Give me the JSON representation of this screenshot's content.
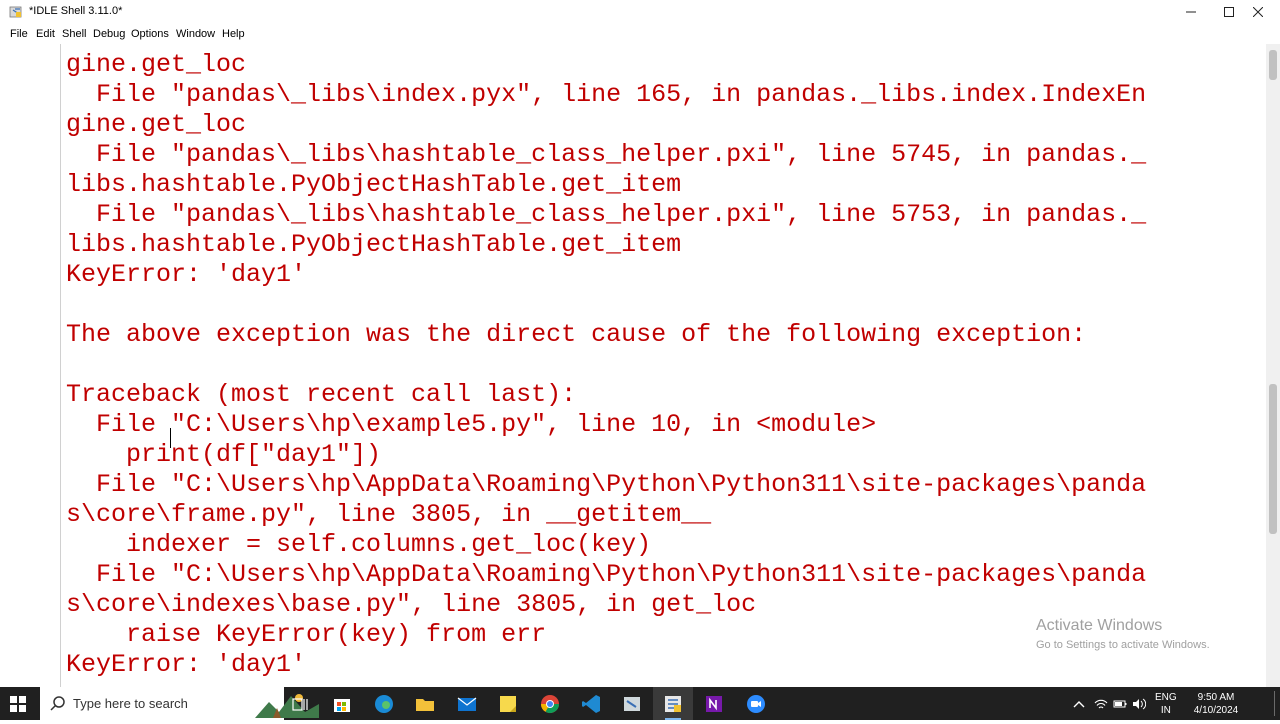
{
  "window": {
    "title": "*IDLE Shell 3.11.0*",
    "controls": {
      "minimize": "—",
      "maximize": "☐",
      "close": "✕"
    }
  },
  "menu": {
    "file": "File",
    "edit": "Edit",
    "shell": "Shell",
    "debug": "Debug",
    "options": "Options",
    "window": "Window",
    "help": "Help"
  },
  "shell": {
    "lines": [
      "gine.get_loc",
      "  File \"pandas\\_libs\\index.pyx\", line 165, in pandas._libs.index.IndexEn",
      "gine.get_loc",
      "  File \"pandas\\_libs\\hashtable_class_helper.pxi\", line 5745, in pandas._",
      "libs.hashtable.PyObjectHashTable.get_item",
      "  File \"pandas\\_libs\\hashtable_class_helper.pxi\", line 5753, in pandas._",
      "libs.hashtable.PyObjectHashTable.get_item",
      "KeyError: 'day1'",
      "",
      "The above exception was the direct cause of the following exception:",
      "",
      "Traceback (most recent call last):",
      "  File \"C:\\Users\\hp\\example5.py\", line 10, in <module>",
      "    print(df[\"day1\"])",
      "  File \"C:\\Users\\hp\\AppData\\Roaming\\Python\\Python311\\site-packages\\panda",
      "s\\core\\frame.py\", line 3805, in __getitem__",
      "    indexer = self.columns.get_loc(key)",
      "  File \"C:\\Users\\hp\\AppData\\Roaming\\Python\\Python311\\site-packages\\panda",
      "s\\core\\indexes\\base.py\", line 3805, in get_loc",
      "    raise KeyError(key) from err",
      "KeyError: 'day1'"
    ]
  },
  "watermark": {
    "title": "Activate Windows",
    "subtitle": "Go to Settings to activate Windows."
  },
  "taskbar": {
    "search_placeholder": "Type here to search",
    "tray": {
      "lang_top": "ENG",
      "lang_bottom": "IN",
      "time": "9:50 AM",
      "date": "4/10/2024"
    },
    "icons": [
      "windows-start-icon",
      "search-icon",
      "task-view-icon",
      "store-icon",
      "edge-icon",
      "file-explorer-icon",
      "mail-icon",
      "sticky-notes-icon",
      "chrome-icon",
      "vscode-icon",
      "python-idle-icon",
      "idle-shell-icon",
      "onenote-icon",
      "zoom-icon"
    ]
  }
}
